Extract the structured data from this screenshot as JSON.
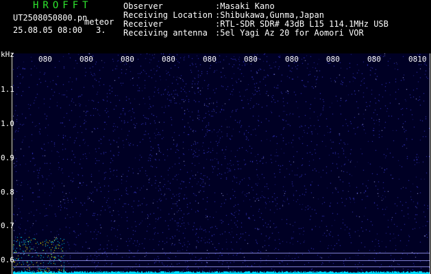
{
  "header": {
    "title": "HROFFT",
    "filename": "UT2508050800.pn",
    "mode": "meteor",
    "date_time": "25.08.05 08:00",
    "count": "3."
  },
  "meta": [
    {
      "key": "Observer",
      "value": ":Masaki Kano"
    },
    {
      "key": "Receiving Location",
      "value": ":Shibukawa,Gunma,Japan"
    },
    {
      "key": "Receiver",
      "value": ":RTL-SDR SDR# 43dB L15 114.1MHz USB"
    },
    {
      "key": "Receiving antenna",
      "value": ":5el Yagi Az 20 for Aomori VOR"
    }
  ],
  "plot": {
    "y_unit": "kHz",
    "y_ticks": [
      "1.1",
      "1.0",
      "0.9",
      "0.8",
      "0.7",
      "0.6"
    ],
    "x_ticks": [
      "080",
      "080",
      "080",
      "080",
      "080",
      "080",
      "080",
      "080",
      "080",
      "0810"
    ],
    "colors": {
      "background": "#000024",
      "noise": "#3a3ad8",
      "bright": "#b0b0ff",
      "baseline": "#00e0ff",
      "hot": "#ffff00"
    }
  }
}
